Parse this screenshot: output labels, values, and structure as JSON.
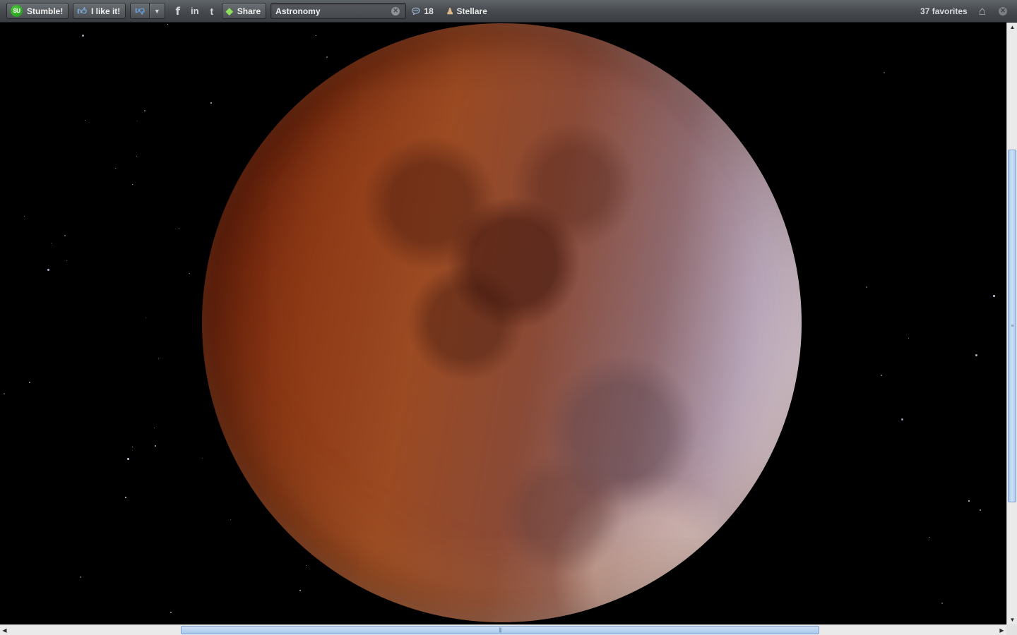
{
  "toolbar": {
    "stumble_label": "Stumble!",
    "stumble_logo_text": "SU",
    "like_label": "I like it!",
    "share_label": "Share",
    "topic_value": "Astronomy",
    "comments_count": "18",
    "username": "Stellare",
    "favorites_text": "37 favorites",
    "icons": {
      "stumble": "stumbleupon-logo-icon",
      "like": "thumbs-up-icon",
      "dislike": "thumbs-down-icon",
      "dropdown": "chevron-down-icon",
      "facebook": "facebook-icon",
      "linkedin": "linkedin-icon",
      "twitter": "twitter-icon",
      "share": "share-gem-icon",
      "topic_clear": "clear-icon",
      "comments": "comment-bubble-icon",
      "user": "user-icon",
      "home": "home-icon",
      "close": "close-icon"
    }
  },
  "content": {
    "image_subject": "eclipsed moon"
  },
  "colors": {
    "toolbar_bg": "#4a4e52",
    "page_bg": "#000000",
    "scroll_thumb": "#a9c8ec"
  }
}
